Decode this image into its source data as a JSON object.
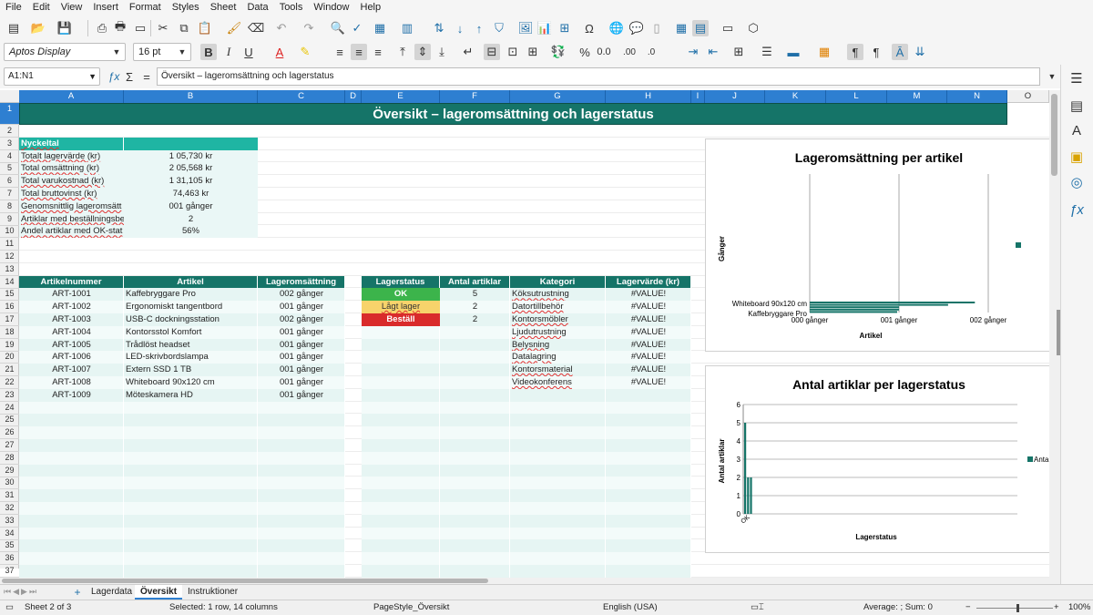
{
  "menu": [
    "File",
    "Edit",
    "View",
    "Insert",
    "Format",
    "Styles",
    "Sheet",
    "Data",
    "Tools",
    "Window",
    "Help"
  ],
  "toolbar2": {
    "font_name": "Aptos Display",
    "font_size": "16 pt"
  },
  "formula_bar": {
    "cell_ref": "A1:N1",
    "content": "Översikt – lageromsättning och lagerstatus"
  },
  "columns": [
    "A",
    "B",
    "C",
    "D",
    "E",
    "F",
    "G",
    "H",
    "I",
    "J",
    "K",
    "L",
    "M",
    "N",
    "O"
  ],
  "rows": [
    "1",
    "2",
    "3",
    "4",
    "5",
    "6",
    "7",
    "8",
    "9",
    "10",
    "11",
    "12",
    "13",
    "14",
    "15",
    "16",
    "17",
    "18",
    "19",
    "20",
    "21",
    "22",
    "23",
    "24",
    "25",
    "26",
    "27",
    "28",
    "29",
    "30",
    "31",
    "32",
    "33",
    "34",
    "35",
    "36",
    "37"
  ],
  "sheet": {
    "title": "Översikt – lageromsättning och lagerstatus",
    "kpi_header": "Nyckeltal",
    "kpis": [
      {
        "label": "Totalt lagervärde (kr)",
        "value": "1 05,730 kr"
      },
      {
        "label": "Total omsättning (kr)",
        "value": "2 05,568 kr"
      },
      {
        "label": "Total varukostnad (kr)",
        "value": "1 31,105 kr"
      },
      {
        "label": "Total bruttovinst (kr)",
        "value": "74,463 kr"
      },
      {
        "label": "Genomsnittlig lageromsätt",
        "value": "001 gånger"
      },
      {
        "label": "Artiklar med beställningsbe",
        "value": "2"
      },
      {
        "label": "Andel artiklar med OK-stat",
        "value": "56%"
      }
    ],
    "items_headers": [
      "Artikelnummer",
      "Artikel",
      "Lageromsättning"
    ],
    "items": [
      {
        "id": "ART-1001",
        "name": "Kaffebryggare Pro",
        "turnover": "002 gånger"
      },
      {
        "id": "ART-1002",
        "name": "Ergonomiskt tangentbord",
        "turnover": "001 gånger"
      },
      {
        "id": "ART-1003",
        "name": "USB-C dockningsstation",
        "turnover": "002 gånger"
      },
      {
        "id": "ART-1004",
        "name": "Kontorsstol Komfort",
        "turnover": "001 gånger"
      },
      {
        "id": "ART-1005",
        "name": "Trådlöst headset",
        "turnover": "001 gånger"
      },
      {
        "id": "ART-1006",
        "name": "LED-skrivbordslampa",
        "turnover": "001 gånger"
      },
      {
        "id": "ART-1007",
        "name": "Extern SSD 1 TB",
        "turnover": "001 gånger"
      },
      {
        "id": "ART-1008",
        "name": "Whiteboard 90x120 cm",
        "turnover": "001 gånger"
      },
      {
        "id": "ART-1009",
        "name": "Möteskamera HD",
        "turnover": "001 gånger"
      }
    ],
    "status_headers": [
      "Lagerstatus",
      "Antal artiklar"
    ],
    "statuses": [
      {
        "label": "OK",
        "count": "5",
        "color": "#3cb44b"
      },
      {
        "label": "Lågt lager",
        "count": "2",
        "color": "#f7d36b"
      },
      {
        "label": "Beställ",
        "count": "2",
        "color": "#d92b2b"
      }
    ],
    "category_headers": [
      "Kategori",
      "Lagervärde (kr)"
    ],
    "categories": [
      {
        "name": "Köksutrustning",
        "value": "#VALUE!"
      },
      {
        "name": "Datortillbehör",
        "value": "#VALUE!"
      },
      {
        "name": "Kontorsmöbler",
        "value": "#VALUE!"
      },
      {
        "name": "Ljudutrustning",
        "value": "#VALUE!"
      },
      {
        "name": "Belysning",
        "value": "#VALUE!"
      },
      {
        "name": "Datalagring",
        "value": "#VALUE!"
      },
      {
        "name": "Kontorsmaterial",
        "value": "#VALUE!"
      },
      {
        "name": "Videokonferens",
        "value": "#VALUE!"
      }
    ]
  },
  "chart_data": [
    {
      "type": "bar",
      "orientation": "horizontal",
      "title": "Lageromsättning per artikel",
      "xlabel": "Artikel",
      "ylabel": "Gånger",
      "categories": [
        "Kaffebryggare Pro",
        "Whiteboard 90x120 cm"
      ],
      "tick_labels": [
        "000 gånger",
        "001 gånger",
        "002 gånger"
      ],
      "legend": "right",
      "color": "#157468",
      "bars": [
        1.85,
        1.55,
        1.0,
        1.0,
        0.98
      ]
    },
    {
      "type": "bar",
      "title": "Antal artiklar per lagerstatus",
      "xlabel": "Lagerstatus",
      "ylabel": "Antal artiklar",
      "ylim": [
        0,
        6
      ],
      "yticks": [
        "0",
        "1",
        "2",
        "3",
        "4",
        "5",
        "6"
      ],
      "series": [
        {
          "name": "Antal",
          "values": [
            5,
            2,
            2
          ]
        }
      ],
      "x_first_label": "OK",
      "legend": "right",
      "color": "#157468"
    }
  ],
  "tabs": [
    "Lagerdata",
    "Översikt",
    "Instruktioner"
  ],
  "status_bar": {
    "sheet": "Sheet 2 of 3",
    "selection": "Selected: 1 row, 14 columns",
    "page_style": "PageStyle_Översikt",
    "language": "English (USA)",
    "sum": "Average: ; Sum: 0",
    "zoom": "100%"
  }
}
